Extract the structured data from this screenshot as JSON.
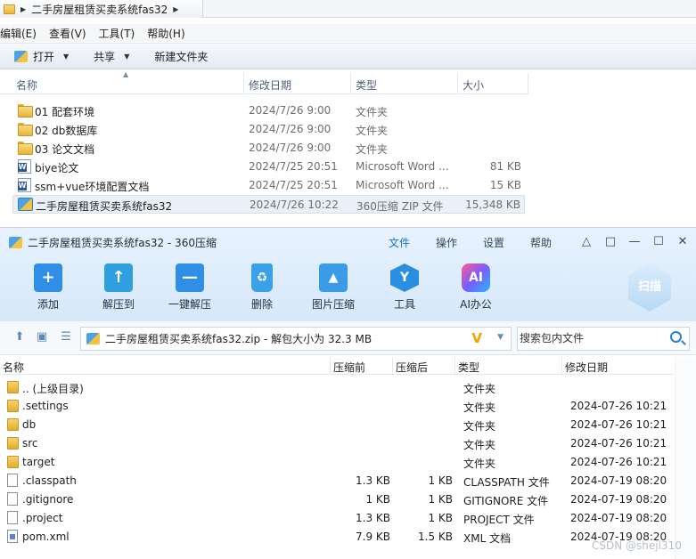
{
  "explorer": {
    "address_path": "二手房屋租赁买卖系统fas32",
    "menu": [
      "编辑(E)",
      "查看(V)",
      "工具(T)",
      "帮助(H)"
    ],
    "toolbar": {
      "open": "打开",
      "share": "共享",
      "new_folder": "新建文件夹"
    },
    "columns": {
      "name": "名称",
      "modified": "修改日期",
      "type": "类型",
      "size": "大小"
    },
    "files": [
      {
        "icon": "folder-icon",
        "name": "01 配套环境",
        "modified": "2024/7/26 9:00",
        "type": "文件夹",
        "size": ""
      },
      {
        "icon": "folder-icon",
        "name": "02 db数据库",
        "modified": "2024/7/26 9:00",
        "type": "文件夹",
        "size": ""
      },
      {
        "icon": "folder-icon",
        "name": "03 论文文档",
        "modified": "2024/7/26 9:00",
        "type": "文件夹",
        "size": ""
      },
      {
        "icon": "word-doc-icon",
        "name": "biye论文",
        "modified": "2024/7/25 20:51",
        "type": "Microsoft Word ...",
        "size": "81 KB"
      },
      {
        "icon": "word-doc-icon",
        "name": "ssm+vue环境配置文档",
        "modified": "2024/7/25 20:51",
        "type": "Microsoft Word ...",
        "size": "15 KB"
      },
      {
        "icon": "zip-archive-icon",
        "name": "二手房屋租赁买卖系统fas32",
        "modified": "2024/7/26 10:22",
        "type": "360压缩 ZIP 文件",
        "size": "15,348 KB",
        "selected": true
      }
    ]
  },
  "zip": {
    "title": "二手房屋租赁买卖系统fas32 - 360压缩",
    "menu": [
      "文件",
      "操作",
      "设置",
      "帮助"
    ],
    "tools": [
      {
        "label": "添加",
        "icon": "add-icon"
      },
      {
        "label": "解压到",
        "icon": "extract-to-icon"
      },
      {
        "label": "一键解压",
        "icon": "one-click-extract-icon"
      },
      {
        "label": "删除",
        "icon": "delete-icon"
      },
      {
        "label": "图片压缩",
        "icon": "image-compress-icon"
      },
      {
        "label": "工具",
        "icon": "tools-icon"
      },
      {
        "label": "AI办公",
        "icon": "ai-office-icon"
      }
    ],
    "scan_label": "扫描",
    "ai_badge": "AI",
    "path": "二手房屋租赁买卖系统fas32.zip - 解包大小为 32.3 MB",
    "search_placeholder": "搜索包内文件",
    "columns": {
      "name": "名称",
      "before": "压缩前",
      "after": "压缩后",
      "type": "类型",
      "modified": "修改日期"
    },
    "entries": [
      {
        "icon": "folder",
        "name": ".. (上级目录)",
        "before": "",
        "after": "",
        "type": "文件夹",
        "modified": ""
      },
      {
        "icon": "folder",
        "name": ".settings",
        "before": "",
        "after": "",
        "type": "文件夹",
        "modified": "2024-07-26 10:21"
      },
      {
        "icon": "folder",
        "name": "db",
        "before": "",
        "after": "",
        "type": "文件夹",
        "modified": "2024-07-26 10:21"
      },
      {
        "icon": "folder",
        "name": "src",
        "before": "",
        "after": "",
        "type": "文件夹",
        "modified": "2024-07-26 10:21"
      },
      {
        "icon": "folder",
        "name": "target",
        "before": "",
        "after": "",
        "type": "文件夹",
        "modified": "2024-07-26 10:21"
      },
      {
        "icon": "doc",
        "name": ".classpath",
        "before": "1.3 KB",
        "after": "1 KB",
        "type": "CLASSPATH 文件",
        "modified": "2024-07-19 08:20"
      },
      {
        "icon": "doc",
        "name": ".gitignore",
        "before": "1 KB",
        "after": "1 KB",
        "type": "GITIGNORE 文件",
        "modified": "2024-07-19 08:20"
      },
      {
        "icon": "doc",
        "name": ".project",
        "before": "1.3 KB",
        "after": "1 KB",
        "type": "PROJECT 文件",
        "modified": "2024-07-19 08:20"
      },
      {
        "icon": "xml",
        "name": "pom.xml",
        "before": "7.9 KB",
        "after": "1.5 KB",
        "type": "XML 文档",
        "modified": "2024-07-19 08:20"
      }
    ],
    "watermark": "CSDN @sheji310"
  }
}
